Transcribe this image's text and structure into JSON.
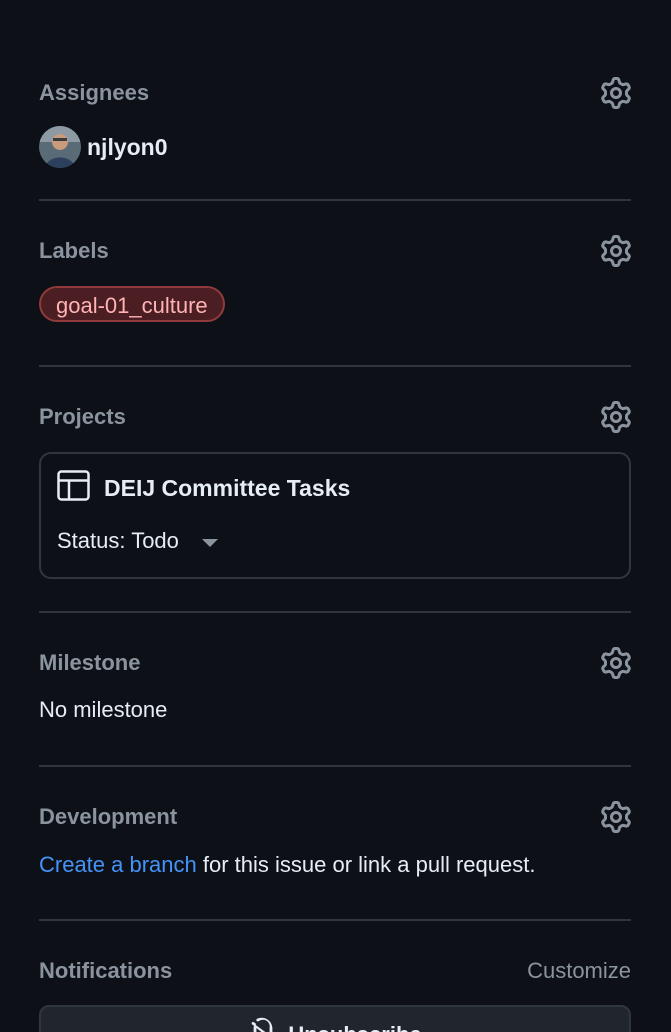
{
  "assignees": {
    "title": "Assignees",
    "user": "njlyon0",
    "settings_icon": "gear-icon"
  },
  "labels": {
    "title": "Labels",
    "items": [
      "goal-01_culture"
    ],
    "settings_icon": "gear-icon"
  },
  "projects": {
    "title": "Projects",
    "project_name": "DEIJ Committee Tasks",
    "project_icon": "table-icon",
    "status": "Status: Todo",
    "settings_icon": "gear-icon"
  },
  "milestone": {
    "title": "Milestone",
    "value": "No milestone",
    "settings_icon": "gear-icon"
  },
  "development": {
    "title": "Development",
    "link_text": "Create a branch",
    "rest_text": " for this issue or link a pull request.",
    "settings_icon": "gear-icon"
  },
  "notifications": {
    "title": "Notifications",
    "customize_label": "Customize",
    "button_label": "Unsubscribe",
    "button_icon": "bell-slash-icon"
  },
  "colors": {
    "background": "#0d1117",
    "muted_text": "#8b949e",
    "link": "#4493f8",
    "label_bg": "#4a1e22",
    "label_border": "#8f3b3b",
    "label_text": "#ffb3b3"
  }
}
